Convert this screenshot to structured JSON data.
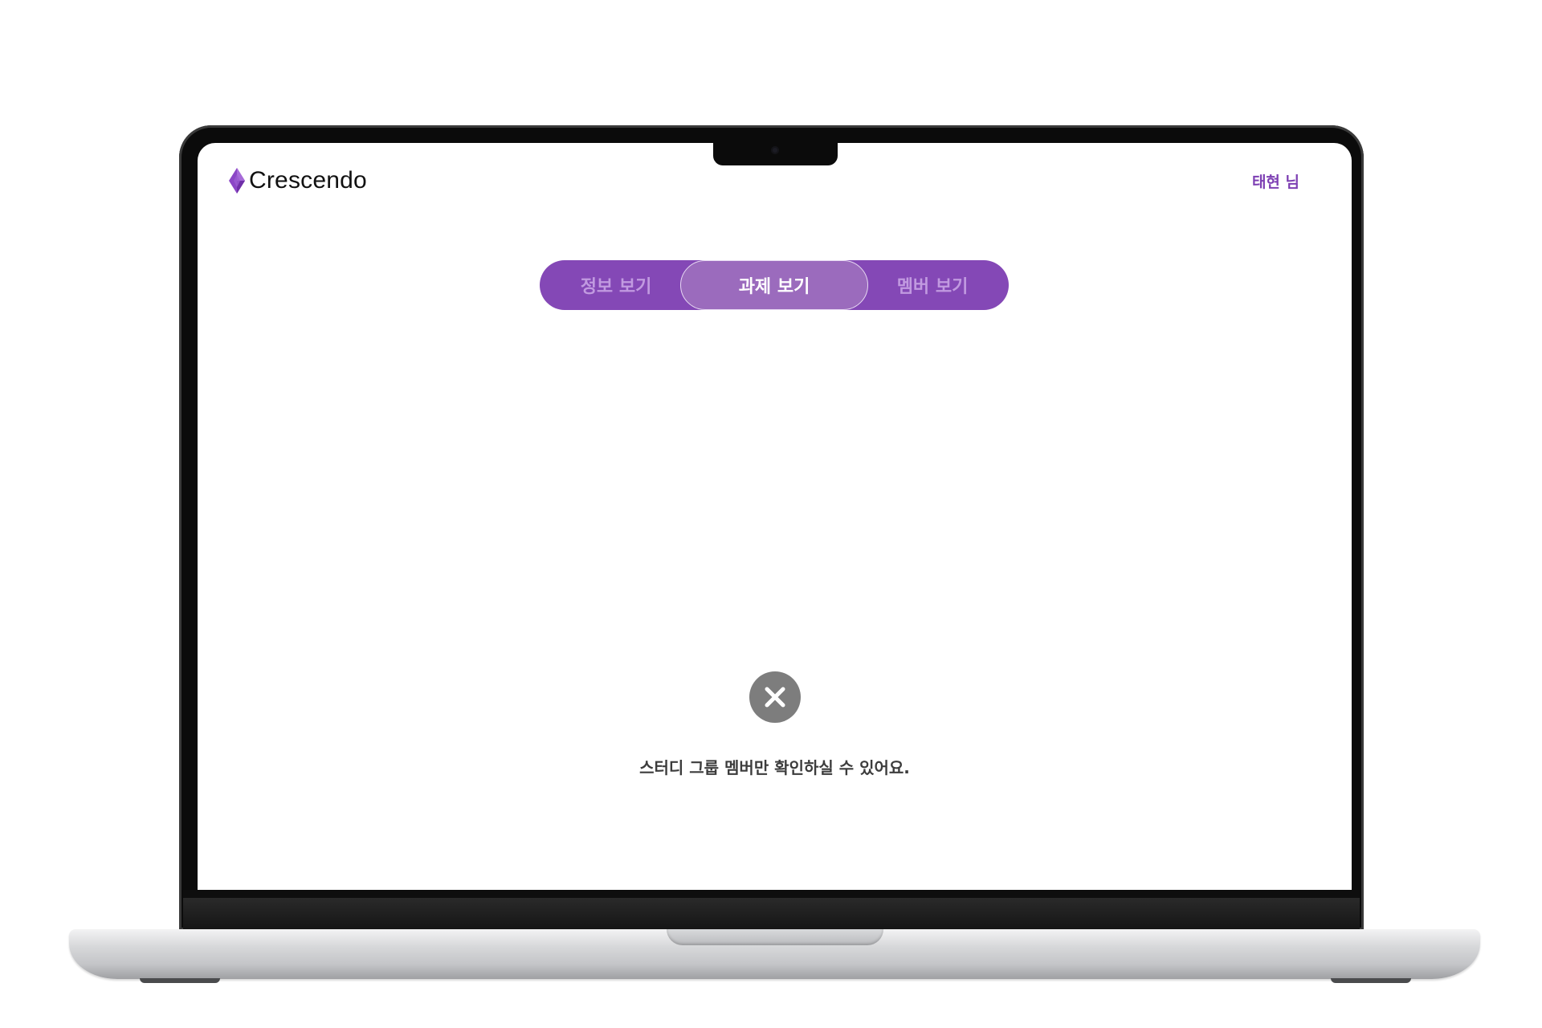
{
  "app": {
    "brand_name": "Crescendo",
    "brand_color": "#7d3fb3",
    "logo_icon": "diamond-icon"
  },
  "header": {
    "user_greeting": "태현 님"
  },
  "tabs": [
    {
      "label": "정보 보기",
      "active": false
    },
    {
      "label": "과제 보기",
      "active": true
    },
    {
      "label": "멤버 보기",
      "active": false
    }
  ],
  "empty_state": {
    "icon": "close-icon",
    "message": "스터디 그룹 멤버만 확인하실 수 있어요."
  },
  "colors": {
    "tab_bar": "#8448b6",
    "tab_active": "#9b6bbd",
    "tab_inactive_text": "#c19ae0",
    "icon_gray": "#7d7d7d"
  }
}
